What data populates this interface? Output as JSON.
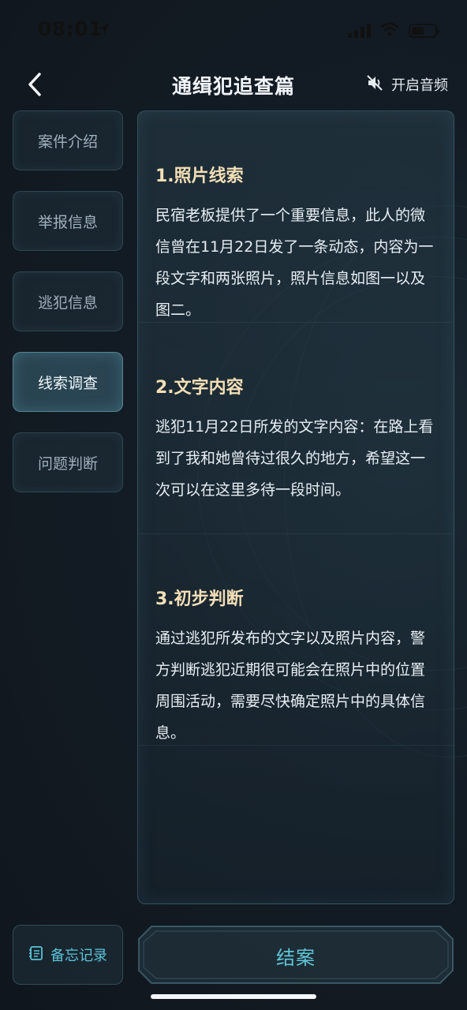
{
  "status": {
    "time": "08:01"
  },
  "header": {
    "title": "通缉犯追查篇",
    "audio_label": "开启音频"
  },
  "sidebar": {
    "items": [
      {
        "label": "案件介绍",
        "active": false
      },
      {
        "label": "举报信息",
        "active": false
      },
      {
        "label": "逃犯信息",
        "active": false
      },
      {
        "label": "线索调查",
        "active": true
      },
      {
        "label": "问题判断",
        "active": false
      }
    ]
  },
  "content": {
    "sections": [
      {
        "title": "1.照片线索",
        "body": "民宿老板提供了一个重要信息，此人的微信曾在11月22日发了一条动态，内容为一段文字和两张照片，照片信息如图一以及图二。"
      },
      {
        "title": "2.文字内容",
        "body": "逃犯11月22日所发的文字内容：在路上看到了我和她曾待过很久的地方，希望这一次可以在这里多待一段时间。"
      },
      {
        "title": "3.初步判断",
        "body": "通过逃犯所发布的文字以及照片内容，警方判断逃犯近期很可能会在照片中的位置周围活动，需要尽快确定照片中的具体信息。"
      }
    ]
  },
  "footer": {
    "memo_label": "备忘记录",
    "close_case_label": "结案"
  },
  "colors": {
    "accent": "#5fc6d8",
    "heading": "#f3dfb6",
    "background": "#131a22"
  }
}
